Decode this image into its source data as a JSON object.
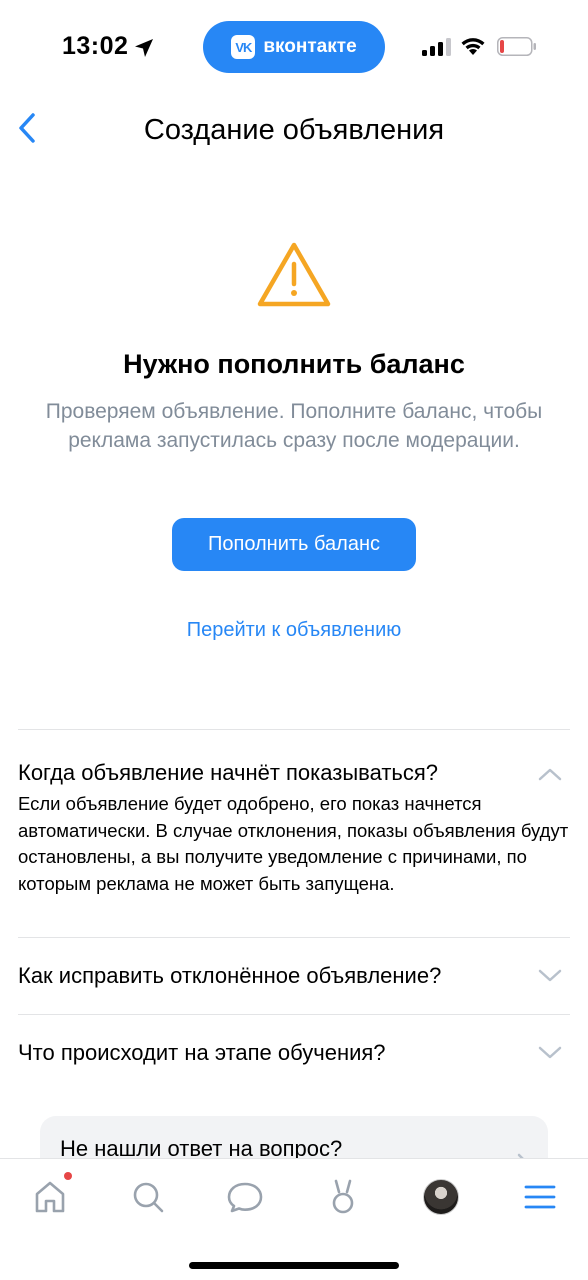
{
  "status_bar": {
    "time": "13:02",
    "app_pill": "вконтакте",
    "app_logo": "VK"
  },
  "header": {
    "title": "Создание объявления",
    "back_icon": "chevron-left-icon"
  },
  "notice": {
    "icon": "warning-icon",
    "heading": "Нужно пополнить баланс",
    "description": "Проверяем объявление. Пополните баланс, чтобы реклама запустилась сразу после модерации.",
    "primary_button": "Пополнить баланс",
    "secondary_link": "Перейти к объявлению"
  },
  "faq": [
    {
      "question": "Когда объявление начнёт показываться?",
      "answer": "Если объявление будет одобрено, его показ начнется автоматически. В случае отклонения, показы объявления будут остановлены, а вы получите уведомление с причинами, по которым реклама не может быть запущена.",
      "expanded": true
    },
    {
      "question": "Как исправить отклонённое объявление?",
      "expanded": false
    },
    {
      "question": "Что происходит на этапе обучения?",
      "expanded": false
    }
  ],
  "help_card": {
    "text": "Не нашли ответ на вопрос?"
  },
  "tab_bar": {
    "tabs": [
      "home-icon",
      "search-icon",
      "messages-icon",
      "clips-icon",
      "profile-avatar",
      "menu-icon"
    ],
    "home_has_notification": true
  },
  "colors": {
    "accent": "#2787F5",
    "warning": "#F5A623",
    "secondary_text": "#818C99",
    "divider": "#E3E4E6",
    "card_bg": "#F2F3F5"
  }
}
